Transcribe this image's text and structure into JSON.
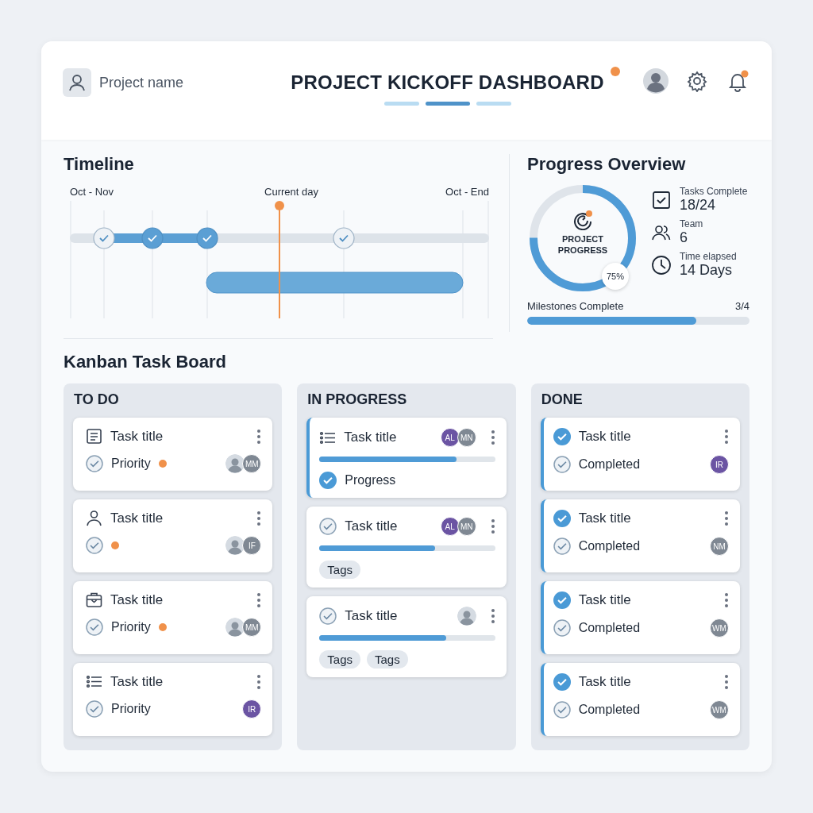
{
  "header": {
    "project_name": "Project name",
    "title": "PROJECT KICKOFF DASHBOARD",
    "title_dot": true,
    "indicators": [
      {
        "selected": false
      },
      {
        "selected": true
      },
      {
        "selected": false
      }
    ],
    "bell_badge": true
  },
  "timeline": {
    "title": "Timeline",
    "start_label": "Oct - Nov",
    "current_label": "Current day",
    "end_label": "Oct - End",
    "milestones": [
      {
        "done": false
      },
      {
        "done": true
      },
      {
        "done": true
      },
      {
        "done": false
      }
    ]
  },
  "progress": {
    "title": "Progress Overview",
    "center_label": "PROJECT PROGRESS",
    "level": 0.75,
    "percent": "75%",
    "stats": [
      {
        "kind": "tasks",
        "label": "Tasks Complete",
        "value": "18/24"
      },
      {
        "kind": "team",
        "label": "Team",
        "value": "6"
      },
      {
        "kind": "time",
        "label": "Time elapsed",
        "value": "14 Days"
      }
    ],
    "milestones": {
      "label": "Milestones Complete",
      "value": "3/4",
      "level": 0.76
    }
  },
  "kanban": {
    "title": "Kanban Task Board",
    "columns": [
      {
        "title": "TO DO",
        "cards": [
          {
            "kind": "document",
            "title": "Task title",
            "accent": false,
            "avatars": [
              {
                "kind": "photo"
              },
              {
                "kind": "initials",
                "initials": "MM",
                "color": "#7f8893"
              }
            ],
            "status": {
              "checked": false,
              "label": "Priority"
            },
            "priority_dot": true
          },
          {
            "kind": "person",
            "title": "Task title",
            "accent": false,
            "avatars": [
              {
                "kind": "photo"
              },
              {
                "kind": "initials",
                "initials": "IF",
                "color": "#7f8893"
              }
            ],
            "status": {
              "checked": false
            },
            "priority_dot": true
          },
          {
            "kind": "briefcase",
            "title": "Task title",
            "accent": false,
            "avatars": [
              {
                "kind": "photo"
              },
              {
                "kind": "initials",
                "initials": "MM",
                "color": "#7f8893"
              }
            ],
            "status": {
              "checked": false,
              "label": "Priority"
            },
            "priority_dot": true
          },
          {
            "kind": "list",
            "title": "Task title",
            "accent": false,
            "avatars": [
              {
                "kind": "initials",
                "initials": "IR",
                "color": "#6b54a3"
              }
            ],
            "status": {
              "checked": false,
              "label": "Priority"
            },
            "priority_dot": false
          }
        ]
      },
      {
        "title": "IN PROGRESS",
        "cards": [
          {
            "kind": "list",
            "title": "Task title",
            "accent": true,
            "avatars": [
              {
                "kind": "initials",
                "initials": "AL",
                "color": "#6b54a3"
              },
              {
                "kind": "initials",
                "initials": "MN",
                "color": "#7f8893"
              }
            ],
            "level": 0.78,
            "status": {
              "checked": true,
              "label": "Progress"
            }
          },
          {
            "kind": "task",
            "checked": false,
            "title": "Task title",
            "accent": false,
            "avatars": [
              {
                "kind": "initials",
                "initials": "AL",
                "color": "#6b54a3"
              },
              {
                "kind": "initials",
                "initials": "MN",
                "color": "#7f8893"
              }
            ],
            "level": 0.66,
            "tags": [
              "Tags"
            ]
          },
          {
            "kind": "task",
            "checked": false,
            "title": "Task title",
            "accent": false,
            "avatars": [
              {
                "kind": "photo"
              }
            ],
            "level": 0.72,
            "tags": [
              "Tags",
              "Tags"
            ]
          }
        ]
      },
      {
        "title": "DONE",
        "cards": [
          {
            "kind": "task",
            "checked": true,
            "title": "Task title",
            "accent": true,
            "avatars": [
              {
                "kind": "initials",
                "initials": "IR",
                "color": "#6b54a3"
              }
            ],
            "status": {
              "checked": false,
              "label": "Completed"
            }
          },
          {
            "kind": "task",
            "checked": true,
            "title": "Task title",
            "accent": true,
            "avatars": [
              {
                "kind": "initials",
                "initials": "NM",
                "color": "#7f8893"
              }
            ],
            "status": {
              "checked": false,
              "label": "Completed"
            }
          },
          {
            "kind": "task",
            "checked": true,
            "title": "Task title",
            "accent": true,
            "avatars": [
              {
                "kind": "initials",
                "initials": "WM",
                "color": "#7f8893"
              }
            ],
            "status": {
              "checked": false,
              "label": "Completed"
            }
          },
          {
            "kind": "task",
            "checked": true,
            "title": "Task title",
            "accent": true,
            "avatars": [
              {
                "kind": "initials",
                "initials": "WM",
                "color": "#7f8893"
              }
            ],
            "status": {
              "checked": false,
              "label": "Completed"
            }
          }
        ]
      }
    ]
  }
}
